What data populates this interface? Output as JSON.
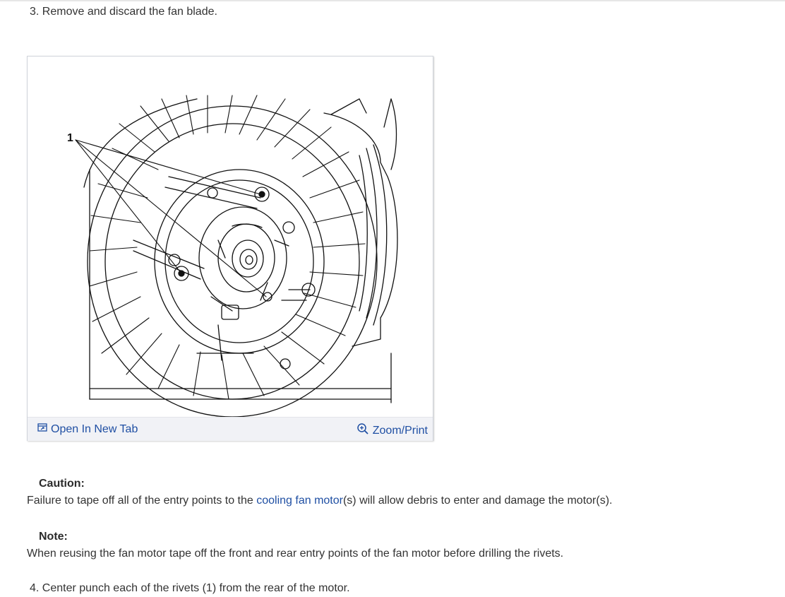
{
  "steps": {
    "step3": "3. Remove and discard the fan blade.",
    "step4": "4. Center punch each of the rivets (1) from the rear of the motor."
  },
  "figure": {
    "callout_label": "1",
    "open_in_new_tab": "Open In New Tab",
    "zoom_print": "Zoom/Print"
  },
  "caution": {
    "title": "Caution:",
    "text_before": "Failure to tape off all of the entry points to the ",
    "link": "cooling fan motor",
    "text_after": "(s) will allow debris to enter and damage the motor(s)."
  },
  "note": {
    "title": "Note:",
    "text": "When reusing the fan motor tape off the front and rear entry points of the fan motor before drilling the rivets."
  },
  "colors": {
    "link": "#1f4fa3",
    "text": "#333333",
    "toolbar_bg": "#f1f2f6"
  }
}
